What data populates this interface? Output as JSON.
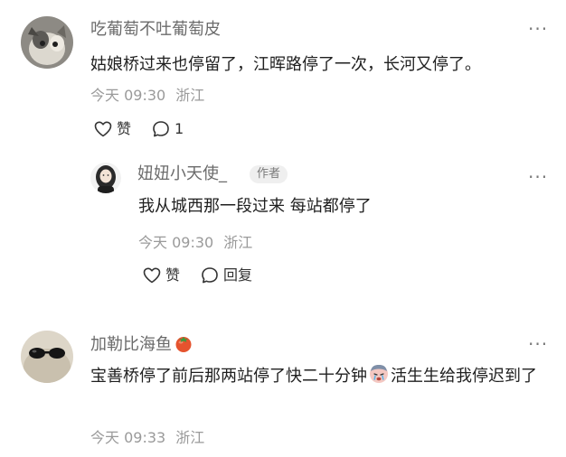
{
  "comments": [
    {
      "username": "吃葡萄不吐葡萄皮",
      "text": "姑娘桥过来也停留了，江晖路停了一次，长河又停了。",
      "time": "今天 09:30",
      "location": "浙江",
      "like_label": "赞",
      "reply_count": "1",
      "more_icon": "more-dots-icon",
      "replies": [
        {
          "username": "妞妞小天使_",
          "badge": "作者",
          "text": "我从城西那一段过来 每站都停了",
          "time": "今天 09:30",
          "location": "浙江",
          "like_label": "赞",
          "reply_label": "回复"
        }
      ]
    },
    {
      "username": "加勒比海鱼",
      "username_emoji": "tomato-icon",
      "text_part1": "宝善桥停了前后那两站停了快二十分钟",
      "text_emoji": "crying-face-icon",
      "text_part2": "活生生给我停迟到了",
      "time": "今天 09:33",
      "location": "浙江"
    }
  ],
  "colors": {
    "text": "#1f1f1f",
    "muted": "#9a9a9a",
    "name": "#6b6b6b",
    "badge_bg": "#efefef"
  }
}
